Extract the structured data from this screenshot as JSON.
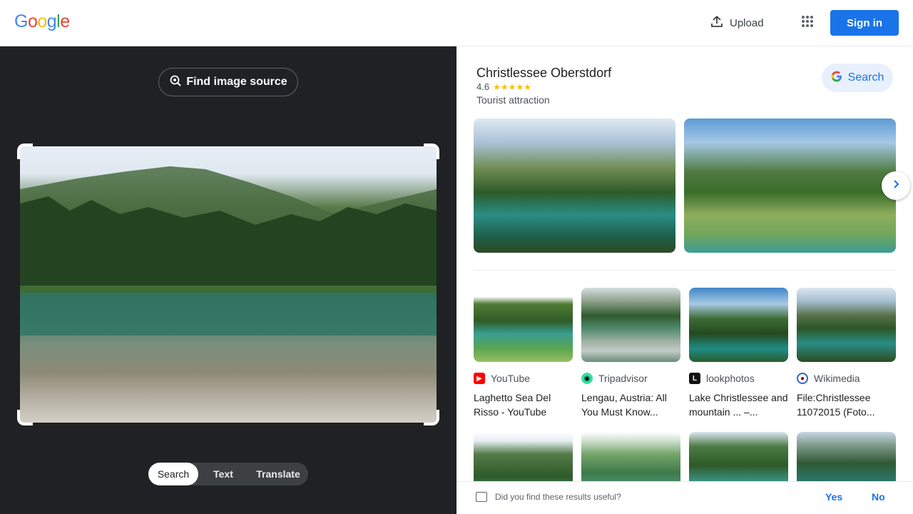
{
  "header": {
    "logo": [
      "G",
      "o",
      "o",
      "g",
      "l",
      "e"
    ],
    "logo_colors": [
      "#4285F4",
      "#EA4335",
      "#FBBC05",
      "#4285F4",
      "#34A853",
      "#EA4335"
    ],
    "upload_label": "Upload",
    "signin_label": "Sign in"
  },
  "left": {
    "find_source_label": "Find image source",
    "tabs": [
      "Search",
      "Text",
      "Translate"
    ],
    "active_tab": "Search"
  },
  "knowledge_panel": {
    "title": "Christlessee Oberstdorf",
    "rating": "4.6",
    "rating_value": 4.6,
    "stars": "★★★★★",
    "subtitle": "Tourist attraction",
    "search_label": "Search"
  },
  "results": [
    {
      "source": "YouTube",
      "favicon_color": "#ff0000",
      "title": "Laghetto Sea Del Risso - YouTube"
    },
    {
      "source": "Tripadvisor",
      "favicon_color": "#34e0a1",
      "title": "Lengau, Austria: All You Must Know..."
    },
    {
      "source": "lookphotos",
      "favicon_color": "#111111",
      "title": "Lake Christlessee and mountain ... –..."
    },
    {
      "source": "Wikimedia",
      "favicon_color": "#3366cc",
      "title": "File:Christlessee 11072015 (Foto..."
    }
  ],
  "feedback": {
    "question": "Did you find these results useful?",
    "yes": "Yes",
    "no": "No"
  }
}
